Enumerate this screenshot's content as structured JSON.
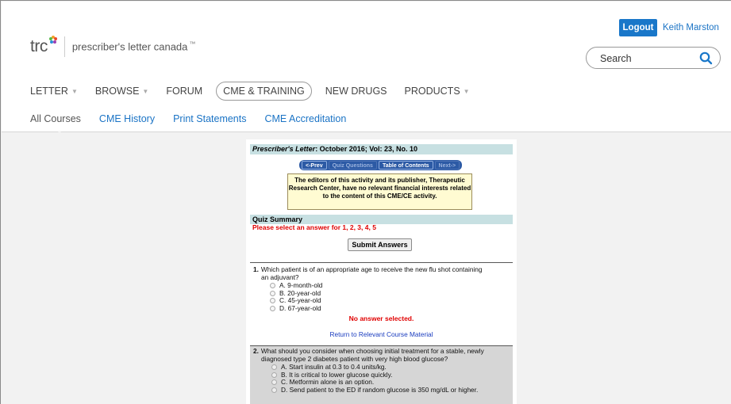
{
  "header": {
    "brand_mark": "trc",
    "brand_name": "prescriber's letter canada",
    "brand_tm": "™",
    "logout_label": "Logout",
    "user_name": "Keith Marston",
    "search_placeholder": "Search"
  },
  "nav": {
    "items": [
      {
        "label": "LETTER",
        "has_caret": true
      },
      {
        "label": "BROWSE",
        "has_caret": true
      },
      {
        "label": "FORUM",
        "has_caret": false
      },
      {
        "label": "CME & TRAINING",
        "has_caret": false,
        "active": true
      },
      {
        "label": "NEW DRUGS",
        "has_caret": false
      },
      {
        "label": "PRODUCTS",
        "has_caret": true
      }
    ],
    "caret": "▼"
  },
  "subnav": {
    "items": [
      "All Courses",
      "CME History",
      "Print Statements",
      "CME Accreditation"
    ]
  },
  "doc": {
    "title_italic": "Prescriber's Letter",
    "title_rest": ": October 2016; Vol: 23, No. 10",
    "navbar": [
      "<-Prev",
      "Quiz Questions",
      "Table of Contents",
      "Next->"
    ],
    "disclaimer": "The editors of this activity and its publisher, Therapeutic Research Center, have no relevant financial interests related to the content of this CME/CE activity.",
    "quiz_summary": "Quiz Summary",
    "warning": "Please select an answer for 1, 2, 3, 4, 5",
    "submit_label": "Submit Answers",
    "q1": {
      "number": "1.",
      "text_line1": "Which patient is of an appropriate age to receive the new flu shot containing",
      "text_line2": "an adjuvant?",
      "options": [
        "A. 9-month-old",
        "B. 20-year-old",
        "C. 45-year-old",
        "D. 67-year-old"
      ],
      "status": "No answer selected.",
      "return_link": "Return to Relevant Course Material"
    },
    "q2": {
      "number": "2.",
      "text_line1": "What should you consider when choosing initial treatment for a stable, newly",
      "text_line2": "diagnosed type 2 diabetes patient with very high blood glucose?",
      "options": [
        "A. Start insulin at 0.3 to 0.4 units/kg.",
        "B. It is critical to lower glucose quickly.",
        "C. Metformin alone is an option.",
        "D. Send patient to the ED if random glucose is 350 mg/dL or higher."
      ]
    }
  },
  "colors": {
    "accent_blue": "#1977c9",
    "link_blue": "#1a73c5",
    "doc_header_bg": "#c7e0e2",
    "warning_red": "#e00000",
    "disclaimer_bg": "#fffbd2"
  }
}
